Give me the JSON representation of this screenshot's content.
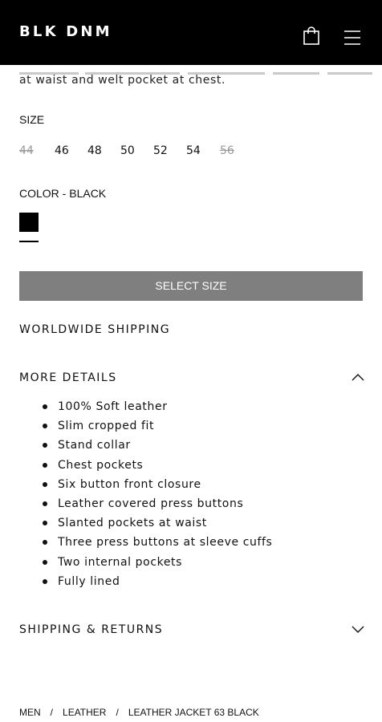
{
  "header": {
    "logo": "BLK DNM",
    "bag_icon": "shopping-bag-icon",
    "menu_icon": "hamburger-menu-icon",
    "background": "#000000"
  },
  "description": {
    "visible_line": "at waist and welt pocket at chest."
  },
  "size": {
    "label": "SIZE",
    "options": [
      {
        "value": "44",
        "available": false
      },
      {
        "value": "46",
        "available": true
      },
      {
        "value": "48",
        "available": true
      },
      {
        "value": "50",
        "available": true
      },
      {
        "value": "52",
        "available": true
      },
      {
        "value": "54",
        "available": true
      },
      {
        "value": "56",
        "available": false
      }
    ]
  },
  "color": {
    "label": "COLOR - BLACK",
    "swatch": "#000000"
  },
  "select_button": {
    "label": "SELECT SIZE",
    "background": "#7f7f7f"
  },
  "shipping": {
    "title": "WORLDWIDE SHIPPING"
  },
  "more_details": {
    "title": "MORE DETAILS",
    "chevron_icon": "chevron-up-icon",
    "items": [
      "100% Soft leather",
      "Slim cropped fit",
      "Stand collar",
      "Chest pockets",
      "Six button front closure",
      "Leather covered press buttons",
      "Slanted pockets at waist",
      "Three press buttons at sleeve cuffs",
      "Two internal pockets",
      "Fully lined"
    ]
  },
  "shipping_returns": {
    "title": "SHIPPING & RETURNS",
    "chevron_icon": "chevron-down-icon"
  },
  "breadcrumb": {
    "items": [
      "MEN",
      "LEATHER",
      "LEATHER JACKET 63 BLACK"
    ],
    "separator": "/"
  }
}
